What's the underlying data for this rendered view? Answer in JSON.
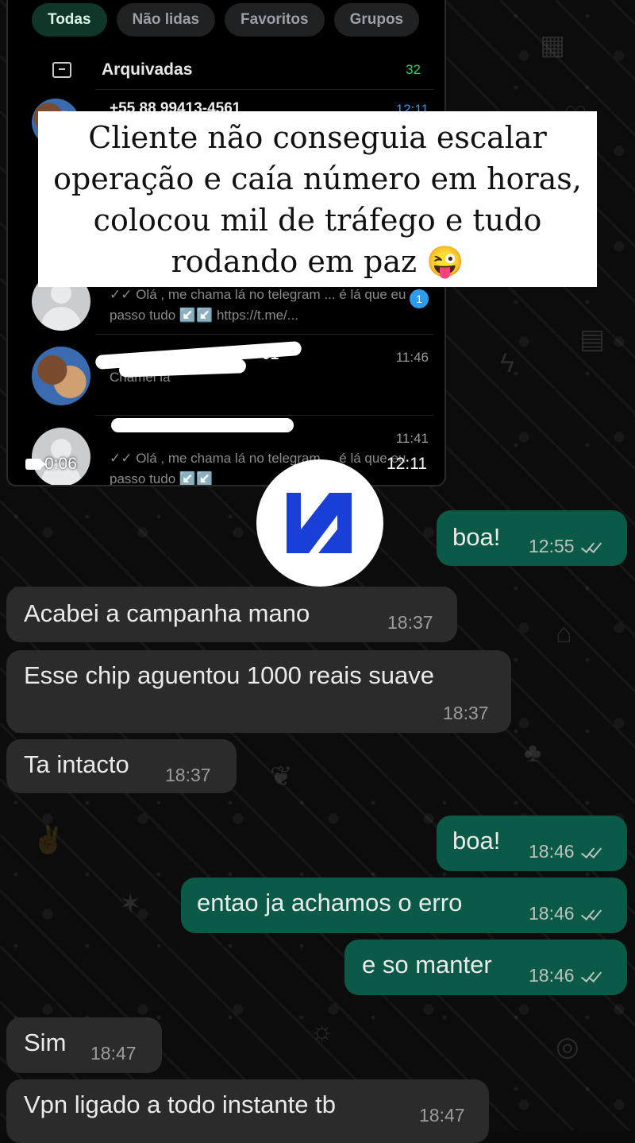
{
  "video": {
    "tabs": [
      "Todas",
      "Não lidas",
      "Favoritos",
      "Grupos"
    ],
    "archived": {
      "label": "Arquivadas",
      "count": "32"
    },
    "partial_row": {
      "name": "+55 88 99413-4561",
      "time": "12:11"
    },
    "chats": [
      {
        "preview": "✓✓ Olá , me chama lá no telegram ... é lá que eu passo tudo ↙️↙️ https://t.me/...",
        "unread": "1"
      },
      {
        "name_suffix": "01",
        "time": "11:46",
        "preview": "Chamei la"
      },
      {
        "time": "11:41",
        "preview": "✓✓ Olá , me chama lá no telegram ... é lá que eu passo tudo ↙️↙️"
      }
    ],
    "duration": "0:06",
    "timestamp": "12:11"
  },
  "caption": "Cliente não conseguia escalar operação e caía número em horas, colocou mil de tráfego e tudo rodando em paz 😜",
  "logo_color": "#1a3fd6",
  "messages": [
    {
      "dir": "out",
      "text": "boa!",
      "time": "12:55"
    },
    {
      "dir": "in",
      "text": "Acabei a campanha mano",
      "time": "18:37"
    },
    {
      "dir": "in",
      "text": "Esse chip aguentou 1000 reais suave",
      "time": "18:37"
    },
    {
      "dir": "in",
      "text": "Ta intacto",
      "time": "18:37"
    },
    {
      "dir": "out",
      "text": "boa!",
      "time": "18:46"
    },
    {
      "dir": "out",
      "text": "entao ja achamos o erro",
      "time": "18:46"
    },
    {
      "dir": "out",
      "text": "e so manter",
      "time": "18:46"
    },
    {
      "dir": "in",
      "text": "Sim",
      "time": "18:47"
    },
    {
      "dir": "in",
      "text": "Vpn ligado a todo instante tb",
      "time": "18:47"
    }
  ],
  "colors": {
    "incoming": "#2b2b2b",
    "outgoing": "#0a5a47",
    "background": "#0b0b0b"
  }
}
